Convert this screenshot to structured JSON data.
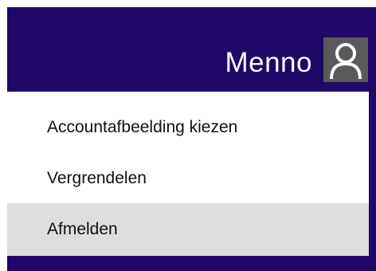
{
  "user": {
    "name": "Menno",
    "avatar_icon": "user-silhouette-icon"
  },
  "menu": {
    "items": [
      {
        "label": "Accountafbeelding kiezen",
        "highlighted": false
      },
      {
        "label": "Vergrendelen",
        "highlighted": false
      },
      {
        "label": "Afmelden",
        "highlighted": true
      }
    ]
  },
  "colors": {
    "header_bg": "#1f0868",
    "menu_bg": "#ffffff",
    "highlight_bg": "#dedede",
    "avatar_bg": "#5a5a5a"
  }
}
